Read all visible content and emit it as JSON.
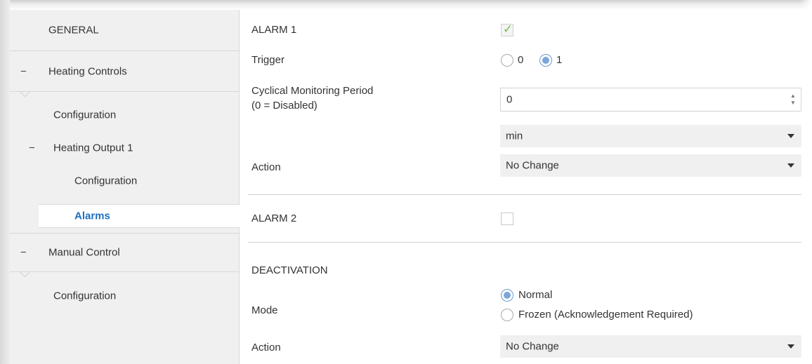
{
  "sidebar": {
    "general": "GENERAL",
    "heating_controls": "Heating Controls",
    "hc_configuration": "Configuration",
    "heating_output_1": "Heating Output 1",
    "ho_configuration": "Configuration",
    "alarms": "Alarms",
    "manual_control": "Manual Control",
    "mc_configuration": "Configuration",
    "collapse_symbol": "−"
  },
  "alarm1": {
    "label": "ALARM 1",
    "enabled": true,
    "check_glyph": "✓",
    "trigger_label": "Trigger",
    "trigger_options": [
      "0",
      "1"
    ],
    "trigger_selected": "1",
    "period_label": "Cyclical Monitoring Period",
    "period_sublabel": "(0 = Disabled)",
    "period_value": "0",
    "unit_value": "min",
    "action_label": "Action",
    "action_value": "No Change"
  },
  "alarm2": {
    "label": "ALARM 2",
    "enabled": false
  },
  "deactivation": {
    "title": "DEACTIVATION",
    "mode_label": "Mode",
    "mode_options": [
      "Normal",
      "Frozen (Acknowledgement Required)"
    ],
    "mode_selected": "Normal",
    "action_label": "Action",
    "action_value": "No Change"
  },
  "colors": {
    "accent": "#1f6fbf",
    "check": "#6cc04a",
    "radio": "#7ba6d8",
    "sidebar_bg": "#f0f0f0"
  }
}
